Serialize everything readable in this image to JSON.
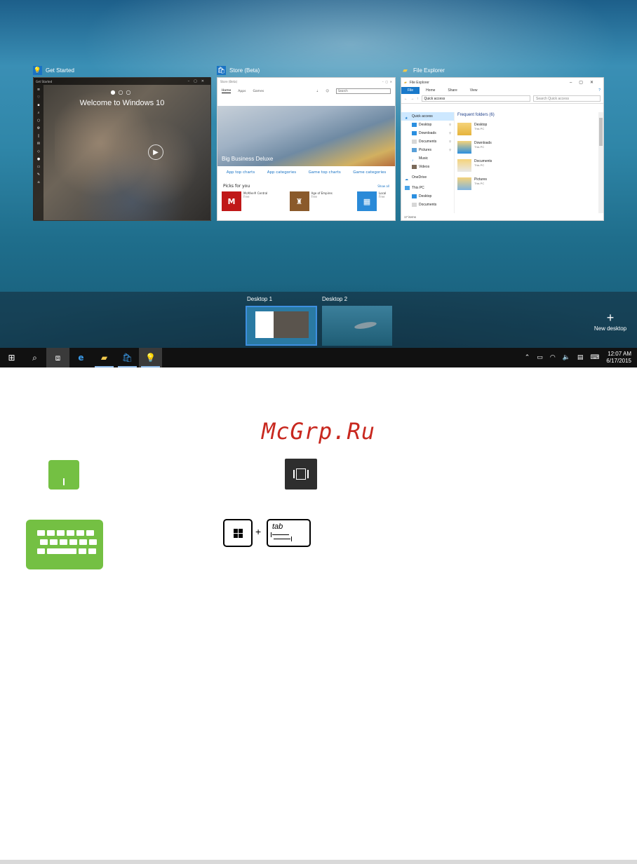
{
  "windows": [
    {
      "id": "get-started",
      "title": "Get Started",
      "icon": "lightbulb-icon"
    },
    {
      "id": "store",
      "title": "Store (Beta)",
      "icon": "store-bag-icon"
    },
    {
      "id": "file-explorer",
      "title": "File Explorer",
      "icon": "folder-icon"
    }
  ],
  "get_started": {
    "window_title": "Get Started",
    "heading": "Welcome to Windows 10"
  },
  "store": {
    "window_title": "Store (Beta)",
    "nav": [
      "Home",
      "Apps",
      "Games"
    ],
    "search_placeholder": "Search",
    "hero_caption": "Big Business Deluxe",
    "links": [
      "App top charts",
      "App categories",
      "Game top charts",
      "Game categories"
    ],
    "picks_heading": "Picks for you",
    "show_all": "Show all",
    "apps": [
      {
        "name": "McAfee® Central",
        "sub": "Free",
        "tile_color": "#c01818",
        "glyph": "M"
      },
      {
        "name": "Age of Empires",
        "sub": "Free",
        "tile_color": "#8a5a2b",
        "glyph": "♜"
      },
      {
        "name": "Local",
        "sub": "Free",
        "tile_color": "#2a8ad8",
        "glyph": "▦"
      }
    ]
  },
  "file_explorer": {
    "window_title": "File Explorer",
    "ribbon": [
      "File",
      "Home",
      "Share",
      "View"
    ],
    "address": "Quick access",
    "search_placeholder": "Search Quick access",
    "nav": {
      "quick_access": "Quick access",
      "qa_items": [
        "Desktop",
        "Downloads",
        "Documents",
        "Pictures",
        "Music",
        "Videos"
      ],
      "onedrive": "OneDrive",
      "this_pc": "This PC",
      "pc_items": [
        "Desktop",
        "Documents"
      ]
    },
    "main_header": "Frequent folders (6)",
    "folders": [
      {
        "name": "Desktop",
        "sub": "This PC"
      },
      {
        "name": "Downloads",
        "sub": "This PC"
      },
      {
        "name": "Documents",
        "sub": "This PC"
      },
      {
        "name": "Pictures",
        "sub": "This PC"
      }
    ],
    "status": "17 items"
  },
  "desktops": {
    "items": [
      "Desktop 1",
      "Desktop 2"
    ],
    "new_desktop": "New desktop",
    "active": "Desktop 1"
  },
  "taskbar": {
    "buttons": [
      "start-icon",
      "search-icon",
      "task-view-icon",
      "edge-icon",
      "file-explorer-icon",
      "store-icon",
      "get-started-icon"
    ],
    "time": "12:07 AM",
    "date": "6/17/2015"
  },
  "watermark": "McGrp.Ru",
  "keys": {
    "tab_label": "tab",
    "plus": "+"
  },
  "colors": {
    "accent_green": "#74c043",
    "taskbar": "#111111",
    "selection_blue": "#3d8fe0",
    "watermark_red": "#c8281f"
  }
}
